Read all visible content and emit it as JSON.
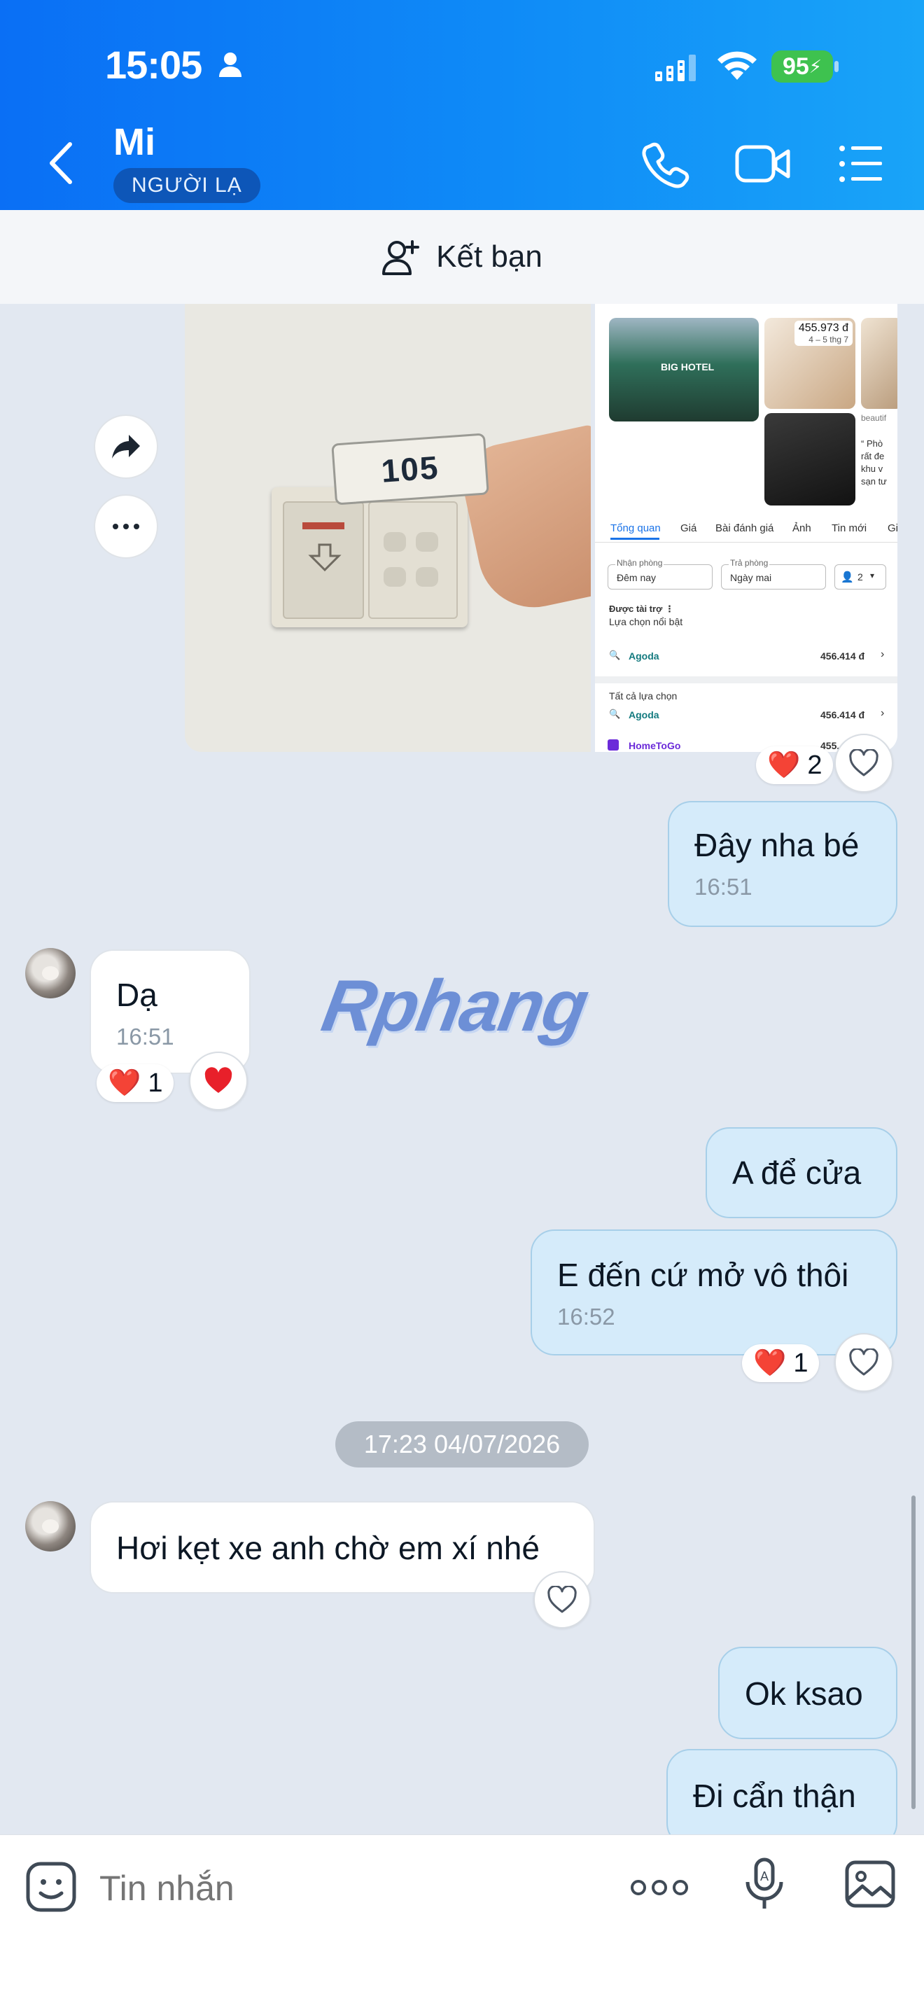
{
  "status_bar": {
    "time": "15:05",
    "battery": "95"
  },
  "header": {
    "contact_name": "Mi",
    "badge": "NGƯỜI LẠ"
  },
  "add_friend": {
    "label": "Kết bạn"
  },
  "screenshot_card": {
    "price_top": "455.973 đ",
    "date_range": "4 – 5 thg 7",
    "hotel_sign": "BIG HOTEL",
    "side_text": [
      "beautif",
      "“ Phò",
      "rất đe",
      "khu v",
      "sạn tư"
    ],
    "tabs": [
      "Tổng quan",
      "Giá",
      "Bài đánh giá",
      "Ảnh",
      "Tin mới",
      "Gi"
    ],
    "checkin_label": "Nhận phòng",
    "checkin_value": "Đêm nay",
    "checkout_label": "Trả phòng",
    "checkout_value": "Ngày mai",
    "guests": "2",
    "sponsored": "Được tài trợ ⋮",
    "featured": "Lựa chọn nổi bật",
    "featured_row": {
      "name": "Agoda",
      "price": "456.414 đ"
    },
    "all_options": "Tất cả lựa chọn",
    "rows": [
      {
        "name": "Agoda",
        "price": "456.414 đ"
      },
      {
        "name": "HomeToGo",
        "price": "455."
      }
    ]
  },
  "room_number": "105",
  "photo_reaction": {
    "count": "2"
  },
  "messages": [
    {
      "text": "Đây nha bé",
      "time": "16:51"
    },
    {
      "text": "Dạ",
      "time": "16:51",
      "reaction_count": "1"
    },
    {
      "text": "A để cửa"
    },
    {
      "text": "E đến cứ mở vô thôi",
      "time": "16:52",
      "reaction_count": "1"
    },
    {
      "text": "Hơi kẹt xe anh chờ em xí nhé"
    },
    {
      "text": "Ok ksao"
    },
    {
      "text": "Đi cẩn thận"
    }
  ],
  "date_divider": "17:23 04/07/2026",
  "watermark": "Rphang",
  "input": {
    "placeholder": "Tin nhắn"
  },
  "colors": {
    "header": "#0a6ff5",
    "outgoing_bubble": "#d5ebfa",
    "background": "#e2e8f1"
  }
}
